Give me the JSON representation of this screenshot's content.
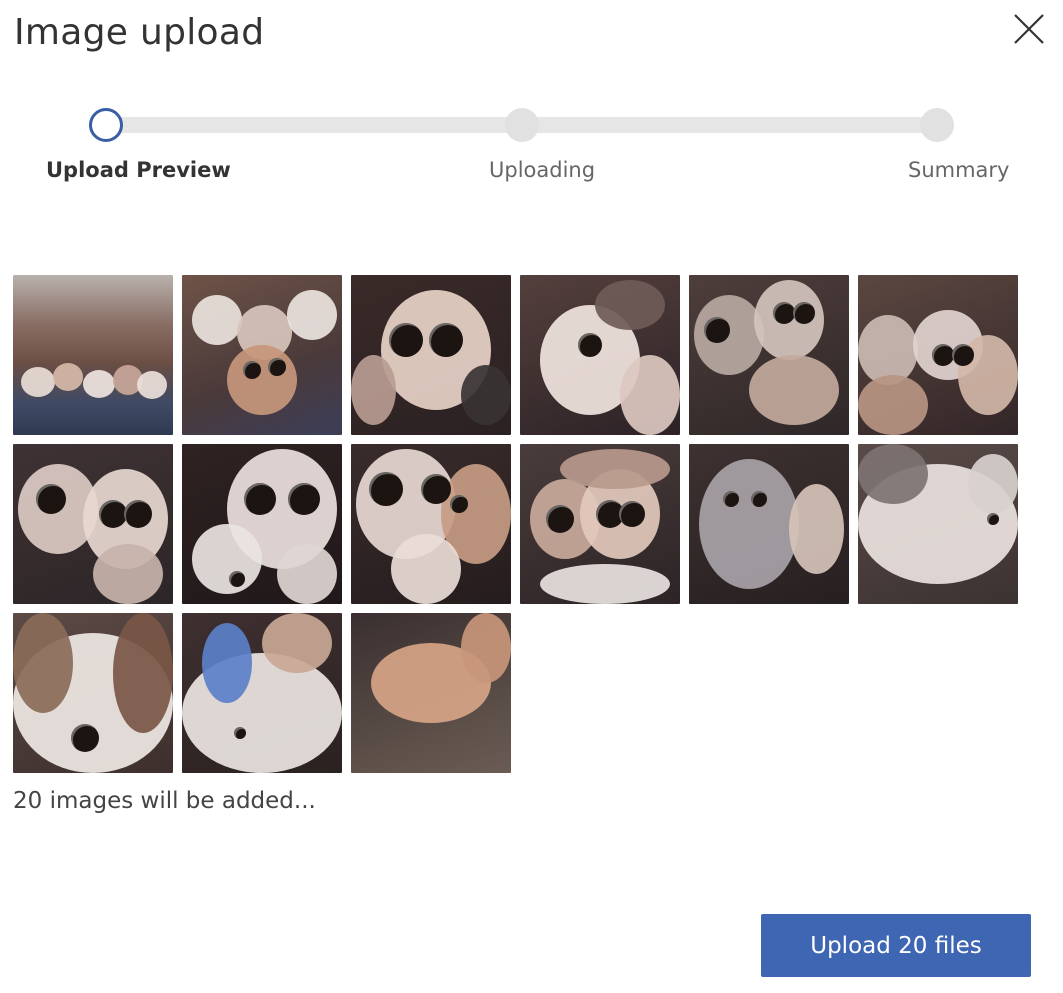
{
  "dialog": {
    "title": "Image upload",
    "close_icon": "close-icon"
  },
  "stepper": {
    "steps": [
      {
        "label": "Upload Preview",
        "state": "active"
      },
      {
        "label": "Uploading",
        "state": "pending"
      },
      {
        "label": "Summary",
        "state": "pending"
      }
    ],
    "active_color": "#3a5ea5",
    "inactive_color": "#e1e1e1"
  },
  "thumbnails": [
    {
      "name": "image-thumbnail"
    },
    {
      "name": "image-thumbnail"
    },
    {
      "name": "image-thumbnail"
    },
    {
      "name": "image-thumbnail"
    },
    {
      "name": "image-thumbnail"
    },
    {
      "name": "image-thumbnail"
    },
    {
      "name": "image-thumbnail"
    },
    {
      "name": "image-thumbnail"
    },
    {
      "name": "image-thumbnail"
    },
    {
      "name": "image-thumbnail"
    },
    {
      "name": "image-thumbnail"
    },
    {
      "name": "image-thumbnail"
    },
    {
      "name": "image-thumbnail"
    },
    {
      "name": "image-thumbnail"
    },
    {
      "name": "image-thumbnail"
    }
  ],
  "summary": {
    "text": "20 images will be added..."
  },
  "actions": {
    "upload_label": "Upload 20 files",
    "upload_color": "#3e66b2"
  }
}
